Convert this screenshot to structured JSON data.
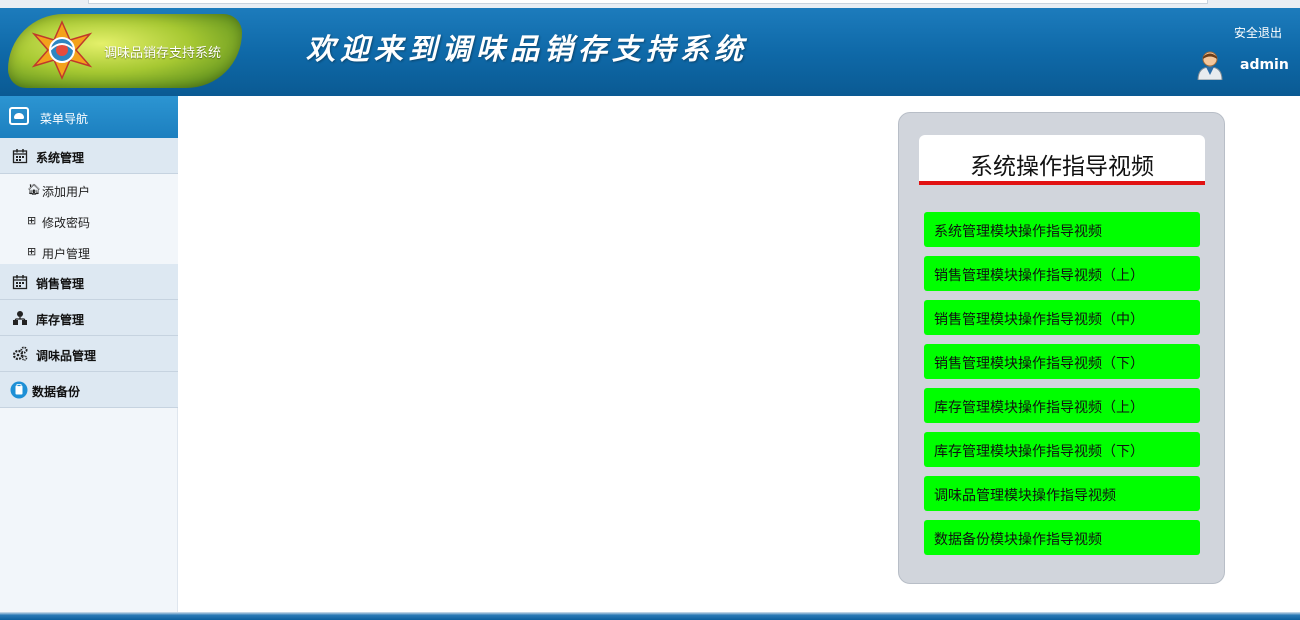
{
  "header": {
    "logo_text": "调味品销存支持系统",
    "welcome": "欢迎来到调味品销存支持系统",
    "logout_label": "安全退出",
    "username": "admin"
  },
  "sidebar": {
    "menu_title": "菜单导航",
    "groups": [
      {
        "label": "系统管理",
        "icon": "calendar-icon",
        "items": [
          {
            "label": "添加用户",
            "icon": "home-icon"
          },
          {
            "label": "修改密码",
            "icon": "grid-icon"
          },
          {
            "label": "用户管理",
            "icon": "grid-icon"
          }
        ]
      },
      {
        "label": "销售管理",
        "icon": "calendar-icon"
      },
      {
        "label": "库存管理",
        "icon": "sitemap-icon"
      },
      {
        "label": "调味品管理",
        "icon": "cogs-icon"
      },
      {
        "label": "数据备份",
        "icon": "clipboard-icon"
      }
    ]
  },
  "video_panel": {
    "title": "系统操作指导视频",
    "buttons": [
      "系统管理模块操作指导视频",
      "销售管理模块操作指导视频（上）",
      "销售管理模块操作指导视频（中）",
      "销售管理模块操作指导视频（下）",
      "库存管理模块操作指导视频（上）",
      "库存管理模块操作指导视频（下）",
      "调味品管理模块操作指导视频",
      "数据备份模块操作指导视频"
    ]
  },
  "colors": {
    "header_blue": "#0f69a8",
    "video_button_green": "#00ff00",
    "title_underline_red": "#e11212"
  }
}
